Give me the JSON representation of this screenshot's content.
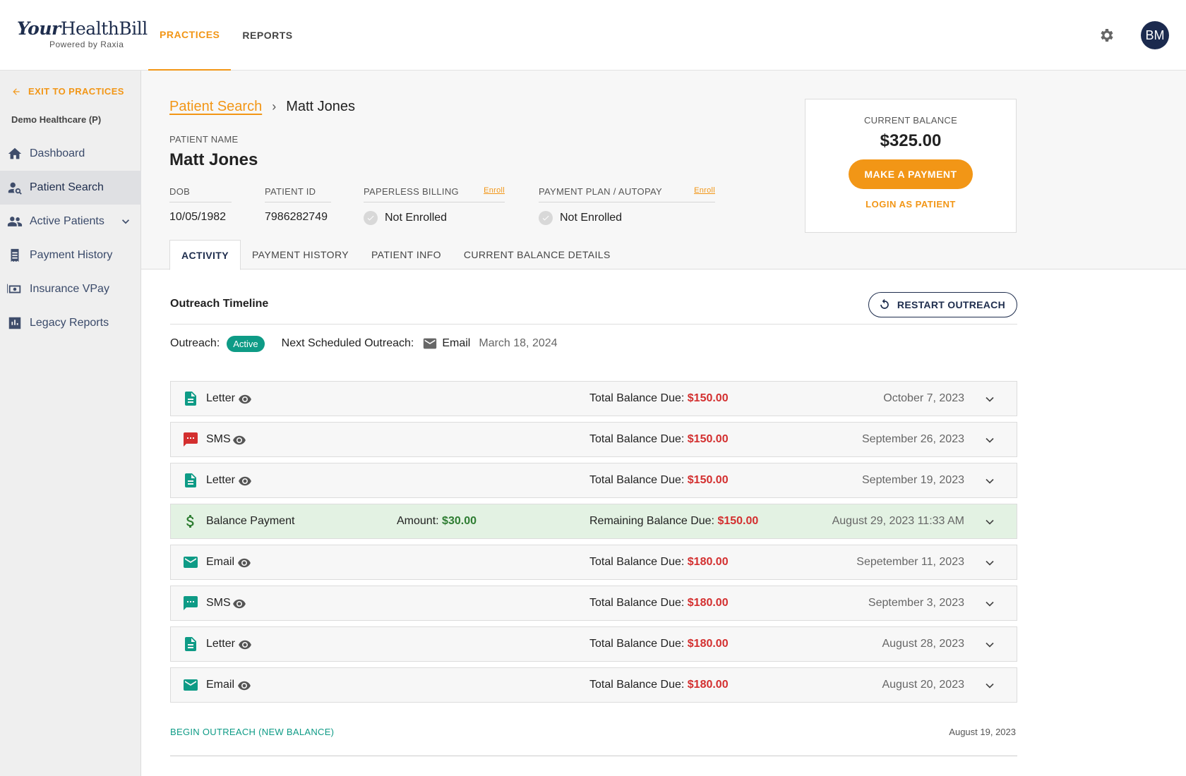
{
  "brand": {
    "logo_italic": "Your",
    "logo_main": "HealthBill",
    "logo_sub": "Powered by Raxia"
  },
  "topnav": [
    {
      "label": "PRACTICES",
      "active": true
    },
    {
      "label": "REPORTS",
      "active": false
    }
  ],
  "user": {
    "initials": "BM"
  },
  "sidebar": {
    "exit_label": "EXIT TO PRACTICES",
    "practice_name": "Demo Healthcare (P)",
    "items": [
      {
        "label": "Dashboard",
        "icon": "home-icon"
      },
      {
        "label": "Patient Search",
        "icon": "person-search-icon",
        "active": true
      },
      {
        "label": "Active Patients",
        "icon": "people-icon"
      },
      {
        "label": "Payment History",
        "icon": "receipt-icon"
      },
      {
        "label": "Insurance VPay",
        "icon": "payment-card-icon"
      },
      {
        "label": "Legacy Reports",
        "icon": "bar-chart-icon"
      }
    ]
  },
  "breadcrumb": {
    "parent": "Patient Search",
    "current": "Matt Jones"
  },
  "patient": {
    "name_label": "PATIENT NAME",
    "name": "Matt Jones",
    "dob_label": "DOB",
    "dob": "10/05/1982",
    "id_label": "PATIENT ID",
    "id": "7986282749",
    "paperless_label": "PAPERLESS BILLING",
    "paperless_value": "Not Enrolled",
    "plan_label": "PAYMENT PLAN / AUTOPAY",
    "plan_value": "Not Enrolled",
    "enroll_label": "Enroll"
  },
  "balance": {
    "title": "CURRENT BALANCE",
    "amount": "$325.00",
    "pay_button": "MAKE A PAYMENT",
    "login_link": "LOGIN AS PATIENT"
  },
  "tabs": [
    {
      "label": "ACTIVITY",
      "active": true
    },
    {
      "label": "PAYMENT HISTORY"
    },
    {
      "label": "PATIENT INFO"
    },
    {
      "label": "CURRENT BALANCE DETAILS"
    }
  ],
  "timeline": {
    "title": "Outreach Timeline",
    "restart_button": "RESTART OUTREACH",
    "outreach_label": "Outreach:",
    "outreach_status": "Active",
    "next_label": "Next Scheduled Outreach:",
    "next_channel": "Email",
    "next_date": "March 18, 2024",
    "rows": [
      {
        "type": "Letter",
        "icon": "document-icon",
        "due_label": "Total Balance Due:",
        "due": "$150.00",
        "date": "October 7, 2023"
      },
      {
        "type": "SMS",
        "icon": "sms-icon",
        "icon_color": "#d32f2f",
        "due_label": "Total Balance Due:",
        "due": "$150.00",
        "date": "September 26, 2023"
      },
      {
        "type": "Letter",
        "icon": "document-icon",
        "due_label": "Total Balance Due:",
        "due": "$150.00",
        "date": "September 19, 2023"
      },
      {
        "type": "Balance Payment",
        "icon": "dollar-icon",
        "payment": true,
        "amount_label": "Amount:",
        "amount": "$30.00",
        "due_label": "Remaining Balance Due:",
        "due": "$150.00",
        "date": "August 29, 2023 11:33 AM"
      },
      {
        "type": "Email",
        "icon": "email-icon",
        "due_label": "Total Balance Due:",
        "due": "$180.00",
        "date": "Sepetember 11, 2023"
      },
      {
        "type": "SMS",
        "icon": "sms-icon",
        "icon_color": "#0e9b86",
        "due_label": "Total Balance Due:",
        "due": "$180.00",
        "date": "September 3, 2023"
      },
      {
        "type": "Letter",
        "icon": "document-icon",
        "due_label": "Total Balance Due:",
        "due": "$180.00",
        "date": "August 28, 2023"
      },
      {
        "type": "Email",
        "icon": "email-icon",
        "due_label": "Total Balance Due:",
        "due": "$180.00",
        "date": "August 20, 2023"
      }
    ],
    "begin_label": "BEGIN OUTREACH (NEW BALANCE)",
    "begin_date": "August 19, 2023"
  },
  "colors": {
    "accent": "#f29616",
    "teal": "#0e9b86",
    "navy": "#1e2d4d",
    "due_red": "#d32f2f",
    "paid_green": "#2e7d32"
  }
}
